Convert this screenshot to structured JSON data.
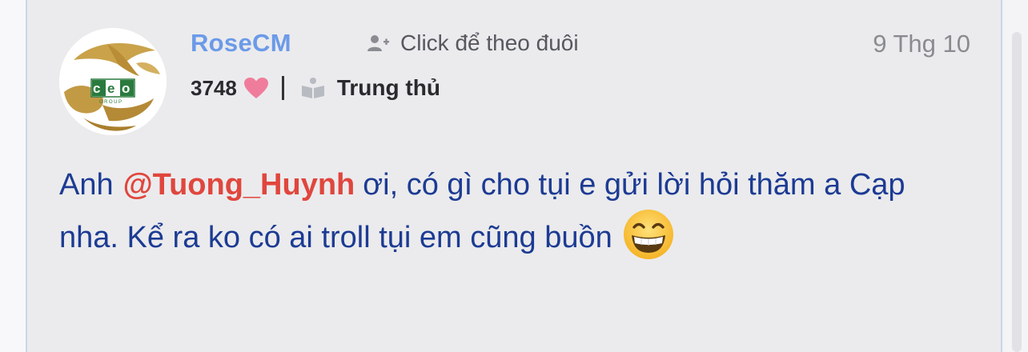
{
  "post": {
    "username": "RoseCM",
    "follow_label": "Click để theo đuôi",
    "date": "9 Thg 10",
    "points": "3748",
    "rank": "Trung thủ",
    "content_before": "Anh",
    "mention": "@Tuong_Huynh",
    "content_after": "ơi, có gì cho tụi e gửi lời hỏi thăm a Cạp nha. Kể ra ko có ai troll tụi em cũng buồn"
  },
  "avatar": {
    "logo_text": "ceo",
    "logo_sub": "GROUP"
  },
  "icons": {
    "follow": "user-plus-icon",
    "points": "heart-icon",
    "rank": "book-icon",
    "emoji": "grinning-face-icon"
  },
  "colors": {
    "username": "#6b9ae8",
    "mention": "#e0463d",
    "content": "#1c3b93",
    "heart": "#f07c9c"
  }
}
